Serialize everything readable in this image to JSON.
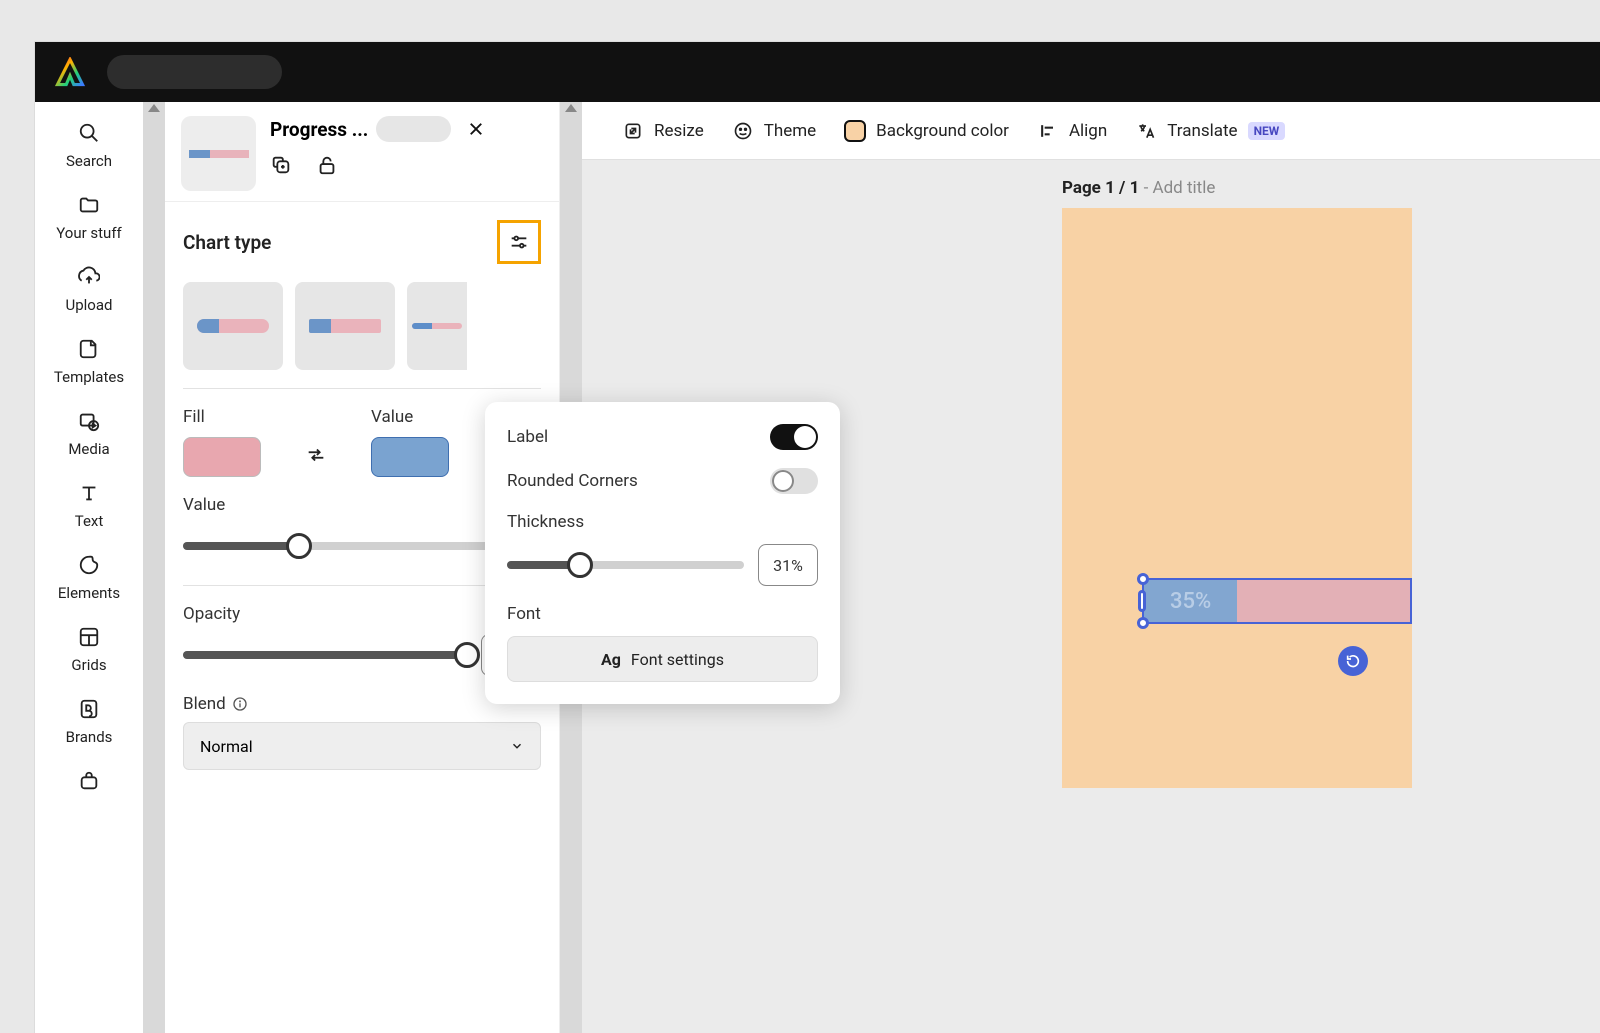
{
  "leftNav": {
    "search": "Search",
    "yourStuff": "Your stuff",
    "upload": "Upload",
    "templates": "Templates",
    "media": "Media",
    "text": "Text",
    "elements": "Elements",
    "grids": "Grids",
    "brands": "Brands"
  },
  "panel": {
    "title": "Progress ...",
    "chartTypeHeading": "Chart type",
    "fillLabel": "Fill",
    "valueLabelHeading": "Value",
    "valueSliderLabel": "Value",
    "valueSliderPct": 35,
    "opacityLabel": "Opacity",
    "opacityValue": "100%",
    "opacityPct": 100,
    "blendLabel": "Blend",
    "blendValue": "Normal"
  },
  "popover": {
    "labelText": "Label",
    "labelOn": true,
    "roundedText": "Rounded Corners",
    "roundedOn": false,
    "thicknessText": "Thickness",
    "thicknessValue": "31%",
    "thicknessPct": 31,
    "fontText": "Font",
    "fontSettings": "Font settings"
  },
  "toolbar": {
    "resize": "Resize",
    "theme": "Theme",
    "background": "Background color",
    "align": "Align",
    "translate": "Translate",
    "newBadge": "NEW"
  },
  "canvas": {
    "pagePrefix": "Page 1 / 1",
    "pageSuffix": " - Add title",
    "progressValue": "35%"
  },
  "colors": {
    "fillSwatch": "#e8a7af",
    "valueSwatch": "#7aa3d0",
    "docBg": "#f8d2a5"
  }
}
